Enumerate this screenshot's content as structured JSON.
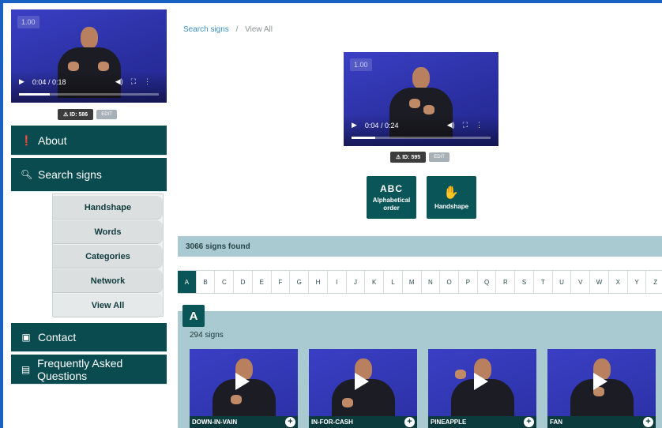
{
  "top_video": {
    "speed": "1.00",
    "time": "0:04 / 0:18",
    "progress": 0.22,
    "id_label": "ID: 586",
    "edit_label": "EDIT"
  },
  "main_video": {
    "speed": "1.00",
    "time": "0:04 / 0:24",
    "progress": 0.17,
    "id_label": "ID: 595",
    "edit_label": "EDIT"
  },
  "sidebar": {
    "about": "About",
    "search": "Search signs",
    "sub_items": [
      "Handshape",
      "Words",
      "Categories",
      "Network",
      "View All"
    ],
    "contact": "Contact",
    "faq": "Frequently Asked Questions"
  },
  "breadcrumb": {
    "link": "Search signs",
    "separator": "/",
    "current": "View All"
  },
  "modes": {
    "alpha_icon": "ABC",
    "alpha_label": "Alphabetical order",
    "hand_label": "Handshape"
  },
  "found_text": "3066 signs found",
  "letters": [
    "A",
    "B",
    "C",
    "D",
    "E",
    "F",
    "G",
    "H",
    "I",
    "J",
    "K",
    "L",
    "M",
    "N",
    "O",
    "P",
    "Q",
    "R",
    "S",
    "T",
    "U",
    "V",
    "W",
    "X",
    "Y",
    "Z"
  ],
  "active_letter": "A",
  "section": {
    "letter": "A",
    "count": "294 signs"
  },
  "signs": [
    "DOWN-IN-VAIN",
    "IN-FOR-CASH",
    "PINEAPPLE",
    "FAN"
  ],
  "colors": {
    "brand": "#0a4b4f",
    "section_bg": "#a8cad0",
    "link": "#3c8fc7",
    "video_bg": "#2f34b0"
  }
}
